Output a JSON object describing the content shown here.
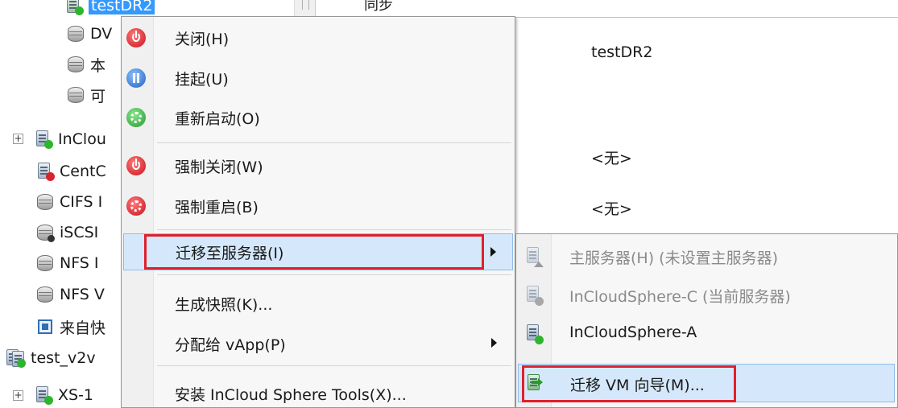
{
  "tree": {
    "items": [
      {
        "label": "testDR2",
        "icon": "vm-running-icon",
        "selected": true
      },
      {
        "label": "DV",
        "icon": "disk-icon"
      },
      {
        "label": "本",
        "icon": "disk-icon"
      },
      {
        "label": "可",
        "icon": "disk-icon"
      },
      {
        "label": "InClou",
        "icon": "host-running-icon"
      },
      {
        "label": "CentC",
        "icon": "vm-stopped-icon"
      },
      {
        "label": "CIFS I",
        "icon": "disk-icon"
      },
      {
        "label": "iSCSI",
        "icon": "iscsi-disk-icon"
      },
      {
        "label": "NFS I",
        "icon": "disk-icon"
      },
      {
        "label": "NFS V",
        "icon": "disk-icon"
      },
      {
        "label": "来自快",
        "icon": "vm-template-icon"
      },
      {
        "label": "test_v2v",
        "icon": "host-group-icon"
      },
      {
        "label": "XS-1",
        "icon": "host-running-icon"
      }
    ]
  },
  "detail": {
    "top_label": "同步",
    "name_value": "testDR2",
    "value1": "<无>",
    "value2": "<无>"
  },
  "context_menu": {
    "items": [
      {
        "label": "关闭(H)",
        "icon": "power-off-icon"
      },
      {
        "label": "挂起(U)",
        "icon": "pause-icon"
      },
      {
        "label": "重新启动(O)",
        "icon": "restart-icon"
      },
      {
        "label": "强制关闭(W)",
        "icon": "force-shutdown-icon"
      },
      {
        "label": "强制重启(B)",
        "icon": "force-restart-icon"
      },
      {
        "label": "迁移至服务器(I)",
        "icon": "",
        "submenu": true
      },
      {
        "label": "生成快照(K)...",
        "icon": ""
      },
      {
        "label": "分配给 vApp(P)",
        "icon": "",
        "submenu": true
      },
      {
        "label": "安装 InCloud Sphere Tools(X)...",
        "icon": ""
      }
    ]
  },
  "submenu": {
    "items": [
      {
        "label": "主服务器(H) (未设置主服务器)",
        "icon": "home-server-icon",
        "disabled": true
      },
      {
        "label": "InCloudSphere-C (当前服务器)",
        "icon": "server-disabled-icon",
        "disabled": true
      },
      {
        "label": "InCloudSphere-A",
        "icon": "server-running-icon",
        "disabled": false
      },
      {
        "label": "迁移 VM 向导(M)...",
        "icon": "migrate-wizard-icon",
        "disabled": false
      }
    ]
  },
  "colors": {
    "highlight_bg": "#d5e8fb",
    "highlight_border": "#8fbce8",
    "annotation_red": "#e0202a",
    "running_green": "#2db52d",
    "stop_red": "#d9232d"
  }
}
